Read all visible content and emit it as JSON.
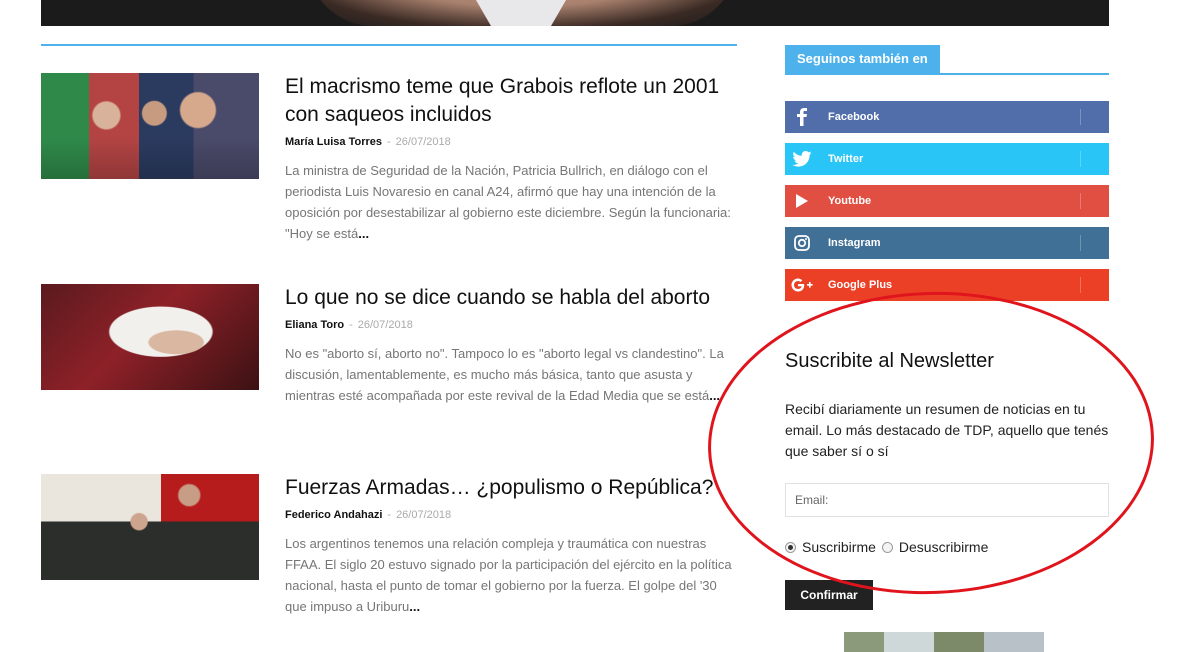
{
  "articles": [
    {
      "title": "El macrismo teme que Grabois reflote un 2001 con saqueos incluidos",
      "author": "María Luisa Torres",
      "sep": "-",
      "date": "26/07/2018",
      "excerpt": "La ministra de Seguridad de la Nación, Patricia Bullrich, en diálogo con el periodista Luis Novaresio en canal A24, afirmó que hay una intención de la oposición por desestabilizar al gobierno este diciembre. Según la funcionaria: \"Hoy se está",
      "more": "..."
    },
    {
      "title": "Lo que no se dice cuando se habla del aborto",
      "author": "Eliana Toro",
      "sep": "-",
      "date": "26/07/2018",
      "excerpt": "No es \"aborto sí, aborto no\". Tampoco lo es \"aborto legal vs clandestino\". La discusión, lamentablemente, es mucho más básica, tanto que asusta y mientras esté acompañada por este revival de la Edad Media que se está",
      "more": "..."
    },
    {
      "title": "Fuerzas Armadas… ¿populismo o República?",
      "author": "Federico Andahazi",
      "sep": "-",
      "date": "26/07/2018",
      "excerpt": "Los argentinos tenemos una relación compleja y traumática con nuestras FFAA. El siglo 20 estuvo signado por la participación del ejército en la política nacional, hasta el punto de tomar el gobierno por la fuerza. El golpe del '30 que impuso a Uriburu",
      "more": "..."
    }
  ],
  "sidebar": {
    "follow_title": "Seguinos también en",
    "social": [
      {
        "label": "Facebook",
        "icon": "facebook-icon",
        "color": "#516eab"
      },
      {
        "label": "Twitter",
        "icon": "twitter-icon",
        "color": "#29c5f6"
      },
      {
        "label": "Youtube",
        "icon": "youtube-icon",
        "color": "#e14e42"
      },
      {
        "label": "Instagram",
        "icon": "instagram-icon",
        "color": "#417096"
      },
      {
        "label": "Google Plus",
        "icon": "google-plus-icon",
        "color": "#eb4026"
      }
    ],
    "newsletter": {
      "title": "Suscribite al Newsletter",
      "description": "Recibí diariamente un resumen de noticias en tu email. Lo más destacado de TDP, aquello que tenés que saber sí o sí",
      "email_placeholder": "Email:",
      "option_subscribe": "Suscribirme",
      "option_unsubscribe": "Desuscribirme",
      "selected": "Suscribirme",
      "confirm_label": "Confirmar"
    }
  },
  "colors": {
    "accent": "#4db2ec",
    "annotation": "#e0141c"
  }
}
